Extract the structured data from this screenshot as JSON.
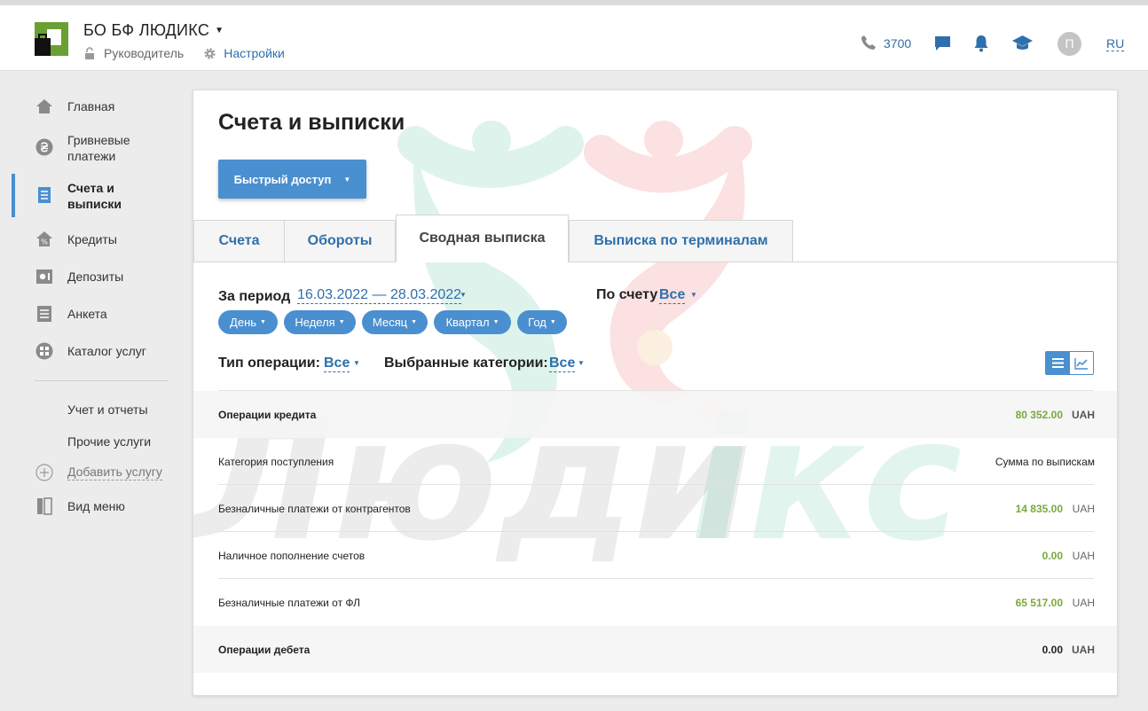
{
  "header": {
    "company": "БО БФ ЛЮДИКС",
    "role": "Руководитель",
    "settings": "Настройки",
    "phone": "3700",
    "avatar_letter": "П",
    "lang": "RU"
  },
  "sidebar": {
    "items": [
      {
        "label": "Главная",
        "icon": "home-icon"
      },
      {
        "label": "Гривневые платежи",
        "icon": "hryvnia-icon"
      },
      {
        "label": "Счета и выписки",
        "icon": "document-icon"
      },
      {
        "label": "Кредиты",
        "icon": "credit-house-icon"
      },
      {
        "label": "Депозиты",
        "icon": "deposit-icon"
      },
      {
        "label": "Анкета",
        "icon": "form-list-icon"
      },
      {
        "label": "Каталог услуг",
        "icon": "catalog-icon"
      }
    ],
    "extra": [
      {
        "label": "Учет и отчеты"
      },
      {
        "label": "Прочие услуги"
      },
      {
        "label": "Добавить услугу",
        "icon": "plus-circle-icon"
      },
      {
        "label": "Вид меню",
        "icon": "menu-view-icon"
      }
    ]
  },
  "main": {
    "title": "Счета и выписки",
    "quick_access": "Быстрый доступ",
    "tabs": [
      {
        "label": "Счета"
      },
      {
        "label": "Обороты"
      },
      {
        "label": "Сводная выписка"
      },
      {
        "label": "Выписка по терминалам"
      }
    ],
    "period_label": "За период",
    "period_value": "16.03.2022 — 28.03.2022",
    "account_label": "По счету",
    "account_value": "Все",
    "period_buttons": [
      "День",
      "Неделя",
      "Месяц",
      "Квартал",
      "Год"
    ],
    "optype_label": "Тип операции:",
    "optype_value": "Все",
    "categories_label": "Выбранные категории:",
    "categories_value": "Все",
    "rows": {
      "credit": {
        "name": "Операции кредита",
        "amount": "80 352.00",
        "currency": "UAH"
      },
      "header": {
        "name": "Категория поступления",
        "right": "Сумма по выпискам"
      },
      "r1": {
        "name": "Безналичные платежи от контрагентов",
        "amount": "14 835.00",
        "currency": "UAH"
      },
      "r2": {
        "name": "Наличное пополнение счетов",
        "amount": "0.00",
        "currency": "UAH"
      },
      "r3": {
        "name": "Безналичные платежи от ФЛ",
        "amount": "65 517.00",
        "currency": "UAH"
      },
      "debit": {
        "name": "Операции дебета",
        "amount": "0.00",
        "currency": "UAH"
      }
    },
    "watermark": "Людиікс"
  },
  "colors": {
    "accent": "#4a8fd0",
    "link": "#2f6fab",
    "amount_green": "#7ba83a",
    "logo_green": "#6aa033"
  }
}
